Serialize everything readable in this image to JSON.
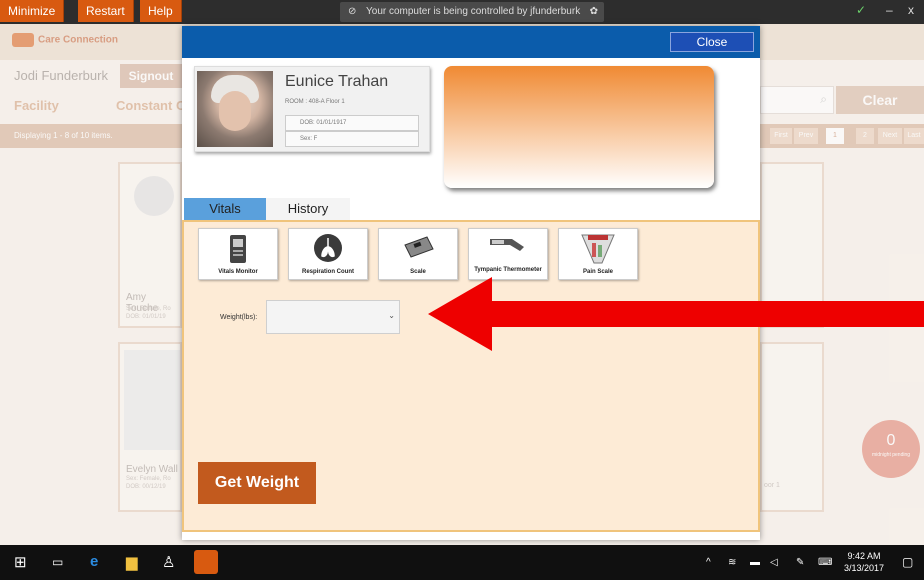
{
  "remote": {
    "buttons": [
      "Minimize",
      "Restart",
      "Help"
    ],
    "notice": "Your computer is being controlled by jfunderburk",
    "window_controls": [
      "✓",
      "–",
      "x"
    ]
  },
  "app": {
    "logo_text": "Care Connection",
    "user": "Jodi Funderburk",
    "signout": "Signout",
    "facility_label": "Facility",
    "constant_label": "Constant C",
    "clear": "Clear",
    "displaying": "Displaying 1 - 8 of 10 items.",
    "pager": [
      "First",
      "Prev",
      "1",
      "2",
      "Next",
      "Last"
    ],
    "cards": [
      {
        "name": "Amy Touche",
        "l1": "Sex: Female, Ro",
        "l2": "DOB: 01/01/19"
      },
      {
        "name": "Evelyn Wall",
        "l1": "Sex: Female, Ro",
        "l2": "DOB: 00/12/19"
      }
    ],
    "card_fragment": "oor 1",
    "pending": {
      "count": "0",
      "label": "midnight pending"
    }
  },
  "modal": {
    "close": "Close",
    "patient": {
      "name": "Eunice Trahan",
      "room": "ROOM : 408-A Floor 1",
      "dob": "DOB: 01/01/1917",
      "sex": "Sex: F"
    },
    "tabs": [
      "Vitals",
      "History"
    ],
    "tools": [
      {
        "label": "Vitals Monitor",
        "icon": "vitals-monitor-icon"
      },
      {
        "label": "Respiration Count",
        "icon": "lungs-icon"
      },
      {
        "label": "Scale",
        "icon": "scale-icon"
      },
      {
        "label": "Tympanic Thermometer",
        "icon": "thermometer-icon"
      },
      {
        "label": "Pain Scale",
        "icon": "pain-scale-icon"
      }
    ],
    "weight_label": "Weight(lbs):",
    "weight_value": "",
    "get_weight": "Get Weight"
  },
  "taskbar": {
    "time": "9:42 AM",
    "date": "3/13/2017"
  },
  "colors": {
    "accent": "#d85a10",
    "modal_header": "#0b5cab",
    "arrow": "#ee0000"
  }
}
